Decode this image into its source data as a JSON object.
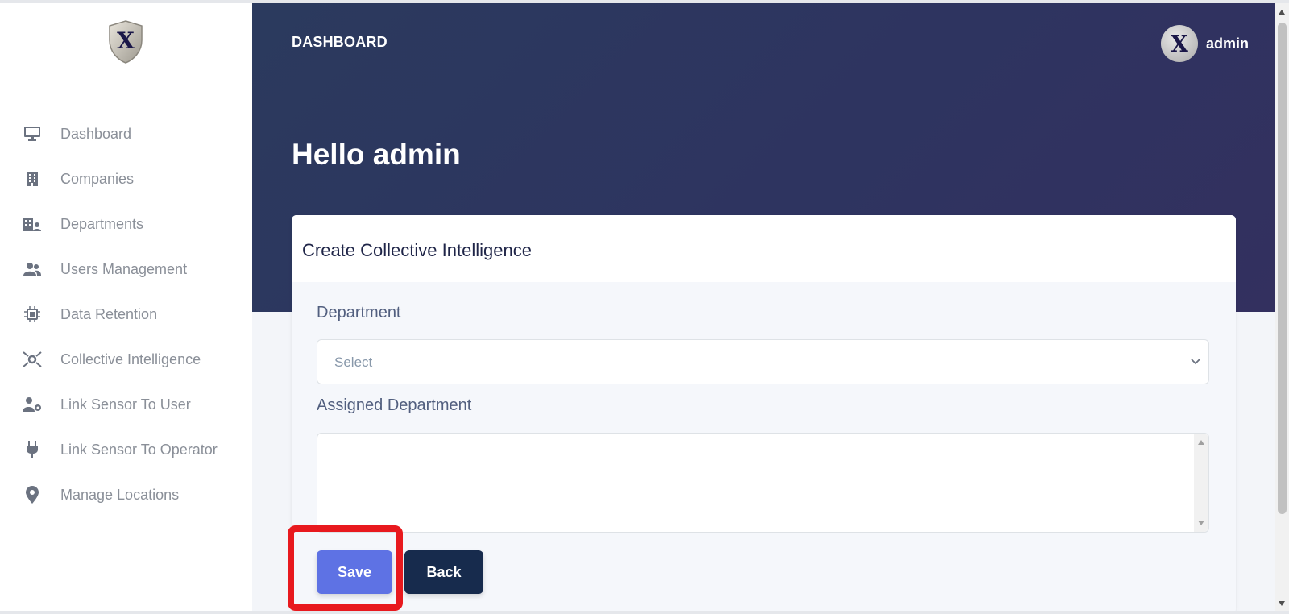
{
  "header": {
    "breadcrumb": "DASHBOARD",
    "user_name": "admin",
    "greeting": "Hello admin"
  },
  "sidebar": {
    "items": [
      {
        "label": "Dashboard",
        "icon": "monitor-icon"
      },
      {
        "label": "Companies",
        "icon": "building-icon"
      },
      {
        "label": "Departments",
        "icon": "department-icon"
      },
      {
        "label": "Users Management",
        "icon": "users-icon"
      },
      {
        "label": "Data Retention",
        "icon": "chip-icon"
      },
      {
        "label": "Collective Intelligence",
        "icon": "network-icon"
      },
      {
        "label": "Link Sensor To User",
        "icon": "user-gear-icon"
      },
      {
        "label": "Link Sensor To Operator",
        "icon": "plug-icon"
      },
      {
        "label": "Manage Locations",
        "icon": "map-pin-icon"
      }
    ]
  },
  "form": {
    "title": "Create Collective Intelligence",
    "department_label": "Department",
    "department_placeholder": "Select",
    "assigned_label": "Assigned Department",
    "assigned_value": "",
    "save_label": "Save",
    "back_label": "Back"
  },
  "colors": {
    "primary": "#5e72e4",
    "dark": "#172b4d",
    "header_bg": "#2e3460",
    "highlight": "#e8191e"
  }
}
